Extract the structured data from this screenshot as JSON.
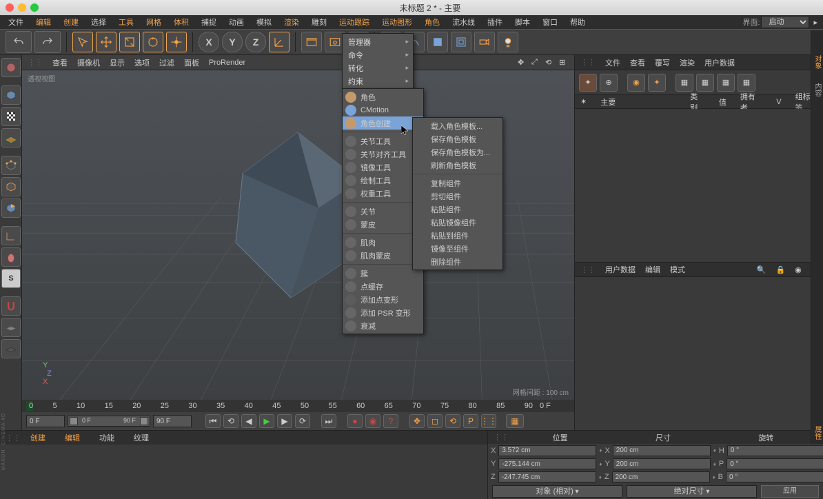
{
  "title": "未标题 2 * - 主要",
  "menubar": [
    "文件",
    "编辑",
    "创建",
    "选择",
    "工具",
    "网格",
    "体积",
    "捕捉",
    "动画",
    "模拟",
    "渲染",
    "雕刻",
    "运动跟踪",
    "运动图形",
    "角色",
    "流水线",
    "插件",
    "脚本",
    "窗口",
    "帮助"
  ],
  "menubar_highlight": [
    false,
    true,
    true,
    false,
    true,
    true,
    true,
    false,
    false,
    false,
    true,
    false,
    true,
    true,
    true,
    false,
    false,
    false,
    false,
    false
  ],
  "layout_label": "界面:",
  "layout_value": "启动",
  "vp_head": [
    "查看",
    "摄像机",
    "显示",
    "选项",
    "过滤",
    "面板",
    "ProRender"
  ],
  "vp_label": "透视视图",
  "grid_info": "网格间距 : 100 cm",
  "timeline_ticks": [
    "0",
    "5",
    "10",
    "15",
    "20",
    "25",
    "30",
    "35",
    "40",
    "45",
    "50",
    "55",
    "60",
    "65",
    "70",
    "75",
    "80",
    "85",
    "90"
  ],
  "timeline_end": "0 F",
  "ctrl_fields": {
    "cur": "0 F",
    "start": "0 F",
    "end": "90 F",
    "out": "90 F"
  },
  "rp_tabs": [
    "文件",
    "查看",
    "覆写",
    "渲染",
    "用户数据"
  ],
  "rp_main_label": "主要",
  "rp_cols": [
    "类别",
    "值",
    "拥有者",
    "V",
    "组标签"
  ],
  "rp_mid": [
    "模式",
    "编辑",
    "用户数据"
  ],
  "bl_tabs": [
    "创建",
    "编辑",
    "功能",
    "纹理"
  ],
  "coord_heads": [
    "位置",
    "尺寸",
    "旋转"
  ],
  "coords": {
    "x": {
      "p": "3.572 cm",
      "s": "200 cm",
      "r": "0 °",
      "rl": "H"
    },
    "y": {
      "p": "-275.144 cm",
      "s": "200 cm",
      "r": "0 °",
      "rl": "P"
    },
    "z": {
      "p": "-247.745 cm",
      "s": "200 cm",
      "r": "0 °",
      "rl": "B"
    }
  },
  "coord_sel1": "对象 (相对)",
  "coord_sel2": "绝对尺寸",
  "coord_apply": "应用",
  "menu1": [
    "管理器",
    "命令",
    "转化",
    "约束"
  ],
  "menu2_top": [
    {
      "l": "角色",
      "i": "#c49a6c"
    },
    {
      "l": "CMotion",
      "i": "#7aa3d8"
    }
  ],
  "menu2_hl": "角色创建",
  "menu2_tools": [
    {
      "l": "关节工具"
    },
    {
      "l": "关节对齐工具"
    },
    {
      "l": "镜像工具"
    },
    {
      "l": "绘制工具"
    },
    {
      "l": "权重工具"
    }
  ],
  "menu2_g3": [
    {
      "l": "关节"
    },
    {
      "l": "蒙皮"
    }
  ],
  "menu2_g4": [
    {
      "l": "肌肉"
    },
    {
      "l": "肌肉蒙皮"
    }
  ],
  "menu2_g5": [
    {
      "l": "簇"
    },
    {
      "l": "点缓存"
    },
    {
      "l": "添加点变形",
      "d": true
    },
    {
      "l": "添加 PSR 变形"
    },
    {
      "l": "衰减"
    }
  ],
  "menu3_top": [
    {
      "l": "载入角色模板..."
    },
    {
      "l": "保存角色模板",
      "d": true
    },
    {
      "l": "保存角色模板为..."
    },
    {
      "l": "刷新角色模板"
    }
  ],
  "menu3_g2": [
    {
      "l": "复制组件",
      "d": true
    },
    {
      "l": "剪切组件",
      "d": true
    },
    {
      "l": "粘贴组件",
      "d": true
    },
    {
      "l": "粘贴镜像组件",
      "d": true
    },
    {
      "l": "粘贴到组件",
      "d": true
    },
    {
      "l": "镜像至组件",
      "d": true
    },
    {
      "l": "删除组件",
      "d": true
    }
  ],
  "rs_tabs": [
    "对象",
    "内容",
    "属性"
  ]
}
